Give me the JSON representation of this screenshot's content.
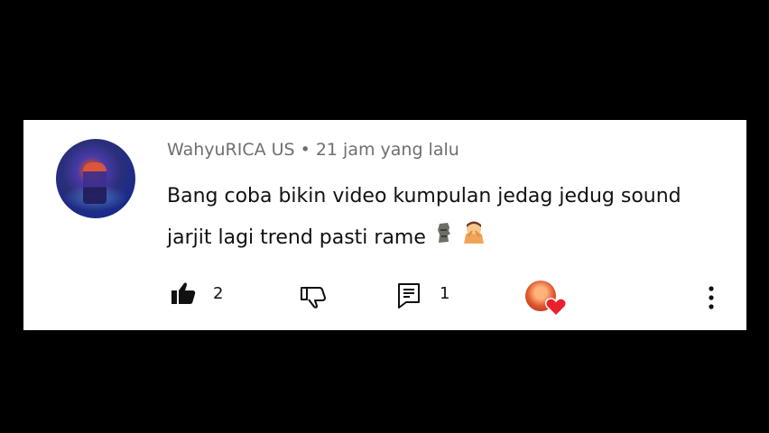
{
  "comment": {
    "author": "WahyuRICA US",
    "separator": "•",
    "timestamp": "21 jam yang lalu",
    "text": "Bang coba bikin video kumpulan jedag jedug sound jarjit lagi trend pasti rame",
    "likes": "2",
    "replies": "1"
  },
  "icons": {
    "like": "thumbs-up-icon",
    "dislike": "thumbs-down-icon",
    "reply": "reply-icon",
    "creator_heart": "heart-icon",
    "more": "more-vertical-icon"
  },
  "colors": {
    "background": "#000000",
    "card": "#ffffff",
    "meta_text": "#6f6f6f",
    "heart": "#e8212b"
  }
}
